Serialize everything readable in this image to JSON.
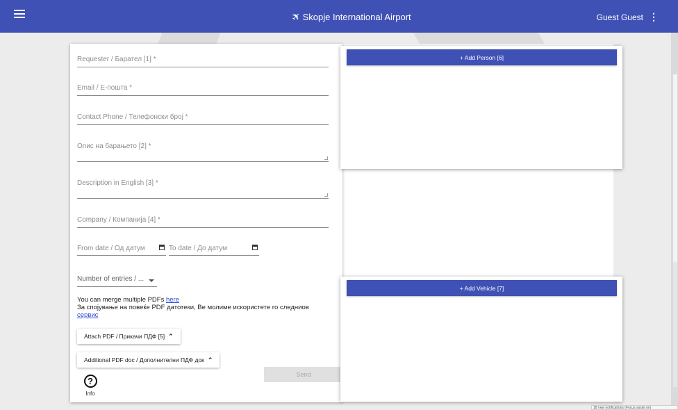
{
  "header": {
    "title": "Skopje International Airport",
    "user": "Guest Guest"
  },
  "form": {
    "requester": "Requester / Барател [1] *",
    "email": "Email / Е-пошта *",
    "phone": "Contact Phone / Телефонски број *",
    "description_mk": "Опис на барањето [2] *",
    "description_en": "Description in English [3] *",
    "company": "Company / Компанија [4] *",
    "from_date": "From date / Од датум",
    "to_date": "To date / До датум",
    "entries": "Number of entries / ...",
    "merge_line1": "You can merge multiple PDFs",
    "merge_link1": "here",
    "merge_line2": "За спојување на повеќе PDF датотеки, Ве молиме искористете го следниов",
    "merge_link2": "сервис",
    "attach_pdf": "Attach PDF / Прикачи ПДФ [5]",
    "additional_pdf": "Additional PDF doc / Дополнителни ПДФ док",
    "send": "Send",
    "info": "Info"
  },
  "panels": {
    "add_person": "+ Add Person [6]",
    "add_vehicle": "+ Add Vehicle [7]"
  },
  "notification": "18 new notifications (Focus assist on)"
}
